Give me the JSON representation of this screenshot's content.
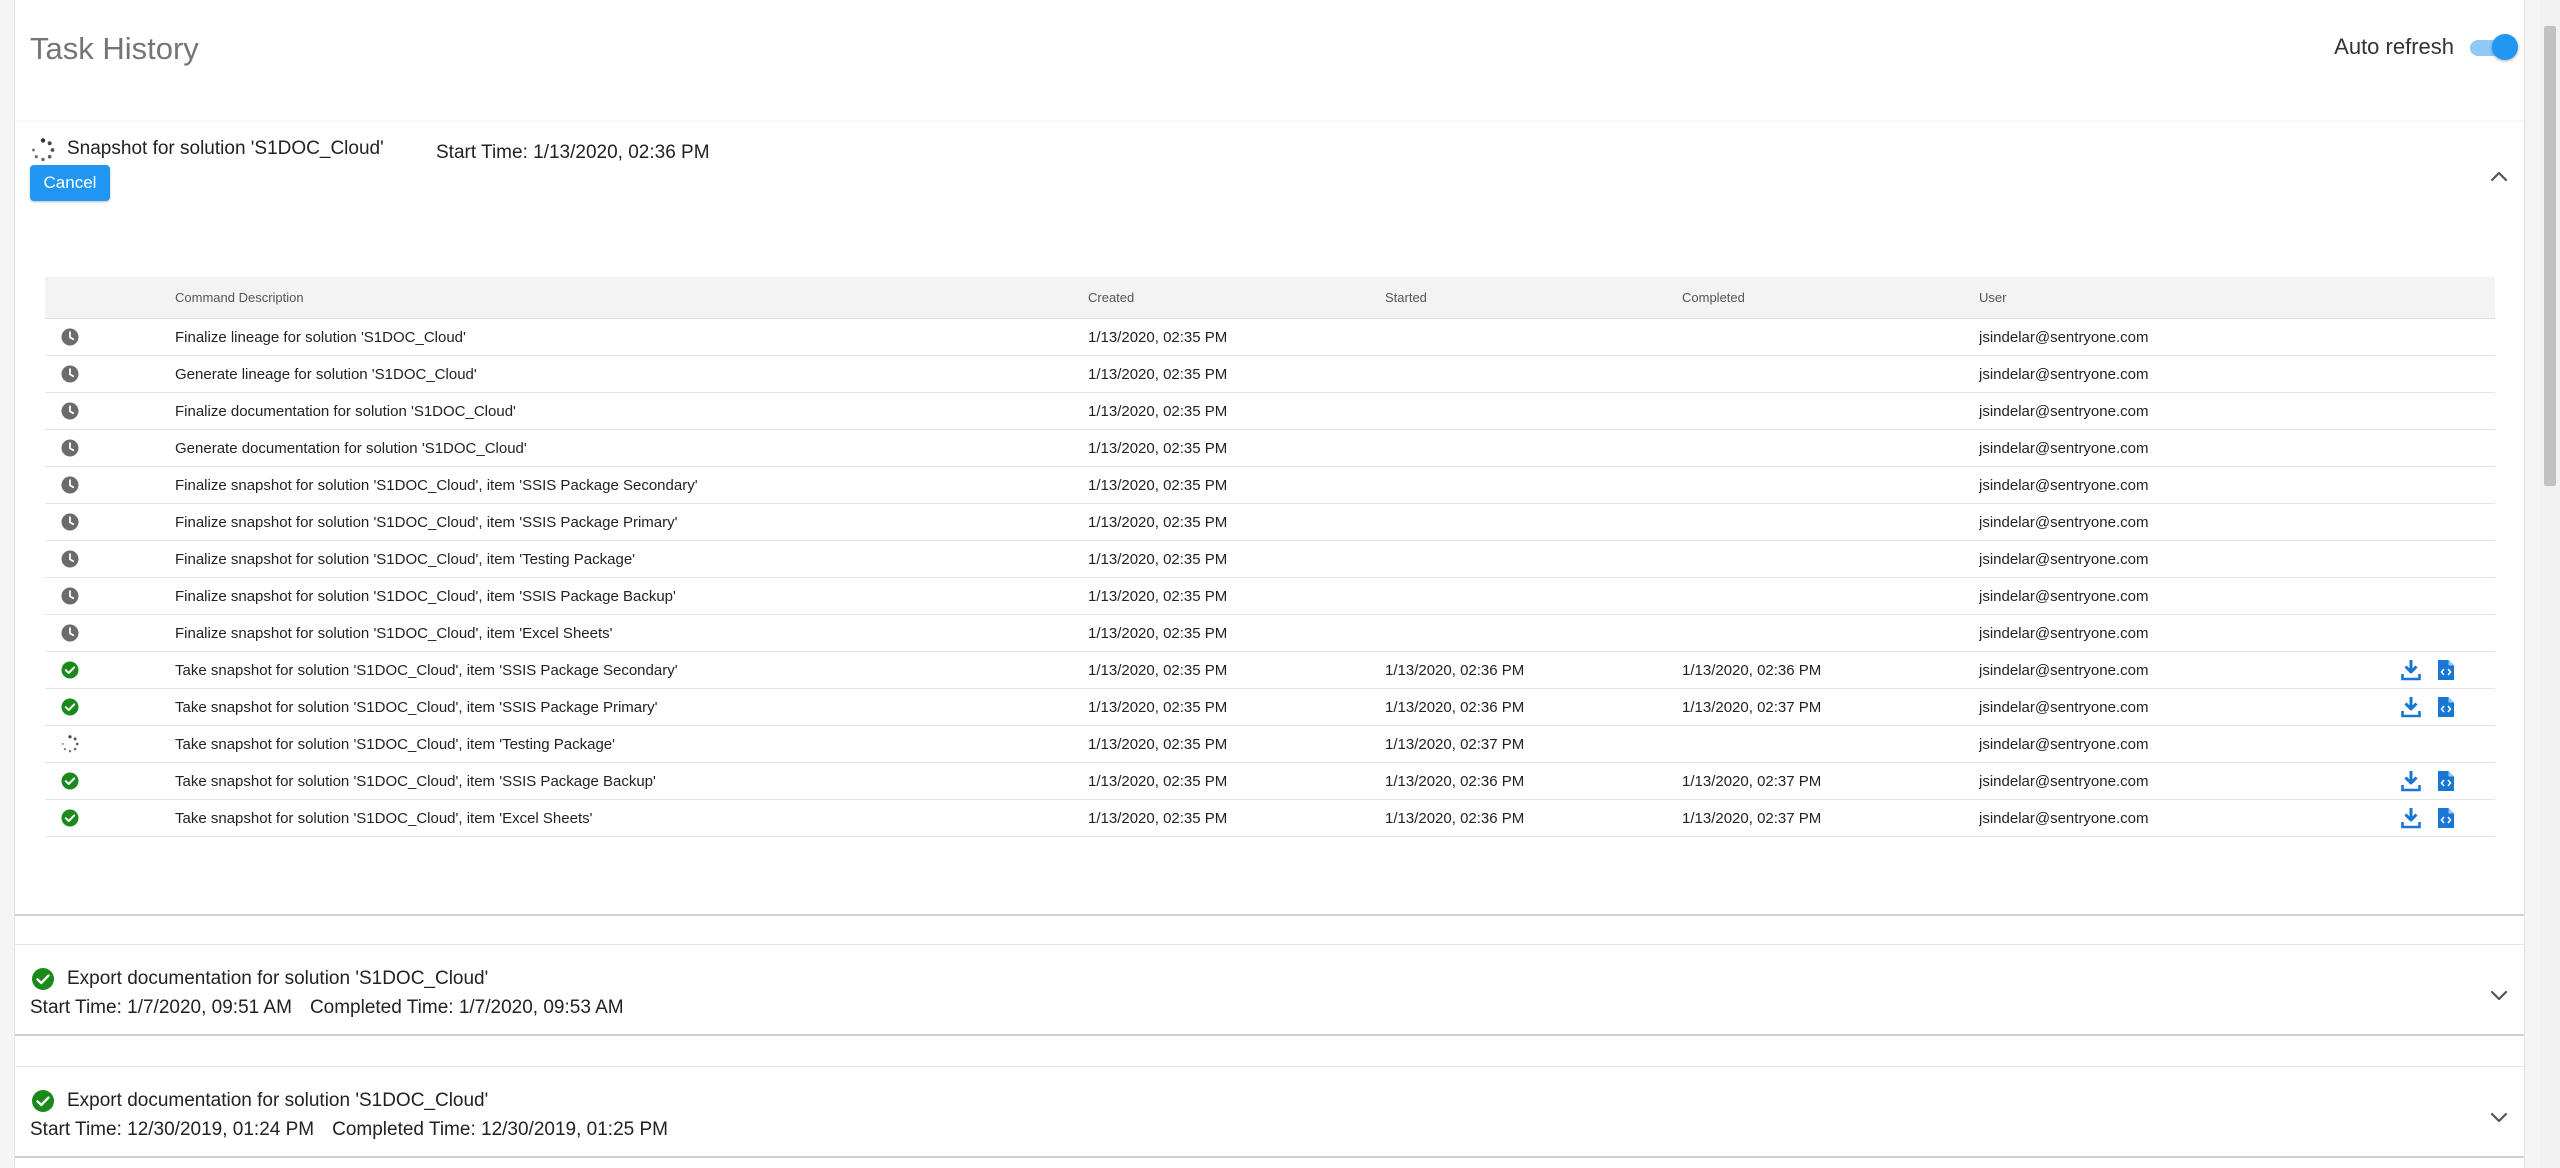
{
  "header": {
    "title": "Task History",
    "auto_refresh_label": "Auto refresh",
    "auto_refresh_on": true
  },
  "colors": {
    "accent": "#2196f3",
    "success": "#1a8a1a",
    "pending": "#757575"
  },
  "tasks": [
    {
      "title": "Snapshot for solution 'S1DOC_Cloud'",
      "status_icon": "spinner-icon",
      "start_time": "Start Time: 1/13/2020, 02:36 PM",
      "cancel_label": "Cancel",
      "expanded": true,
      "table": {
        "columns": [
          "Command Description",
          "Created",
          "Started",
          "Completed",
          "User"
        ],
        "rows": [
          {
            "status": "clock-icon",
            "description": "Finalize lineage for solution 'S1DOC_Cloud'",
            "created": "1/13/2020, 02:35 PM",
            "started": "",
            "completed": "",
            "user": "jsindelar@sentryone.com",
            "actions": false
          },
          {
            "status": "clock-icon",
            "description": "Generate lineage for solution 'S1DOC_Cloud'",
            "created": "1/13/2020, 02:35 PM",
            "started": "",
            "completed": "",
            "user": "jsindelar@sentryone.com",
            "actions": false
          },
          {
            "status": "clock-icon",
            "description": "Finalize documentation for solution 'S1DOC_Cloud'",
            "created": "1/13/2020, 02:35 PM",
            "started": "",
            "completed": "",
            "user": "jsindelar@sentryone.com",
            "actions": false
          },
          {
            "status": "clock-icon",
            "description": "Generate documentation for solution 'S1DOC_Cloud'",
            "created": "1/13/2020, 02:35 PM",
            "started": "",
            "completed": "",
            "user": "jsindelar@sentryone.com",
            "actions": false
          },
          {
            "status": "clock-icon",
            "description": "Finalize snapshot for solution 'S1DOC_Cloud', item 'SSIS Package Secondary'",
            "created": "1/13/2020, 02:35 PM",
            "started": "",
            "completed": "",
            "user": "jsindelar@sentryone.com",
            "actions": false
          },
          {
            "status": "clock-icon",
            "description": "Finalize snapshot for solution 'S1DOC_Cloud', item 'SSIS Package Primary'",
            "created": "1/13/2020, 02:35 PM",
            "started": "",
            "completed": "",
            "user": "jsindelar@sentryone.com",
            "actions": false
          },
          {
            "status": "clock-icon",
            "description": "Finalize snapshot for solution 'S1DOC_Cloud', item 'Testing Package'",
            "created": "1/13/2020, 02:35 PM",
            "started": "",
            "completed": "",
            "user": "jsindelar@sentryone.com",
            "actions": false
          },
          {
            "status": "clock-icon",
            "description": "Finalize snapshot for solution 'S1DOC_Cloud', item 'SSIS Package Backup'",
            "created": "1/13/2020, 02:35 PM",
            "started": "",
            "completed": "",
            "user": "jsindelar@sentryone.com",
            "actions": false
          },
          {
            "status": "clock-icon",
            "description": "Finalize snapshot for solution 'S1DOC_Cloud', item 'Excel Sheets'",
            "created": "1/13/2020, 02:35 PM",
            "started": "",
            "completed": "",
            "user": "jsindelar@sentryone.com",
            "actions": false
          },
          {
            "status": "check-circle-icon",
            "description": "Take snapshot for solution 'S1DOC_Cloud', item 'SSIS Package Secondary'",
            "created": "1/13/2020, 02:35 PM",
            "started": "1/13/2020, 02:36 PM",
            "completed": "1/13/2020, 02:36 PM",
            "user": "jsindelar@sentryone.com",
            "actions": true
          },
          {
            "status": "check-circle-icon",
            "description": "Take snapshot for solution 'S1DOC_Cloud', item 'SSIS Package Primary'",
            "created": "1/13/2020, 02:35 PM",
            "started": "1/13/2020, 02:36 PM",
            "completed": "1/13/2020, 02:37 PM",
            "user": "jsindelar@sentryone.com",
            "actions": true
          },
          {
            "status": "spinner-icon",
            "description": "Take snapshot for solution 'S1DOC_Cloud', item 'Testing Package'",
            "created": "1/13/2020, 02:35 PM",
            "started": "1/13/2020, 02:37 PM",
            "completed": "",
            "user": "jsindelar@sentryone.com",
            "actions": false
          },
          {
            "status": "check-circle-icon",
            "description": "Take snapshot for solution 'S1DOC_Cloud', item 'SSIS Package Backup'",
            "created": "1/13/2020, 02:35 PM",
            "started": "1/13/2020, 02:36 PM",
            "completed": "1/13/2020, 02:37 PM",
            "user": "jsindelar@sentryone.com",
            "actions": true
          },
          {
            "status": "check-circle-icon",
            "description": "Take snapshot for solution 'S1DOC_Cloud', item 'Excel Sheets'",
            "created": "1/13/2020, 02:35 PM",
            "started": "1/13/2020, 02:36 PM",
            "completed": "1/13/2020, 02:37 PM",
            "user": "jsindelar@sentryone.com",
            "actions": true
          }
        ]
      }
    },
    {
      "title": "Export documentation for solution 'S1DOC_Cloud'",
      "status_icon": "check-circle-icon",
      "start_time": "Start Time: 1/7/2020, 09:51 AM",
      "completed_time": "Completed Time: 1/7/2020, 09:53 AM",
      "expanded": false
    },
    {
      "title": "Export documentation for solution 'S1DOC_Cloud'",
      "status_icon": "check-circle-icon",
      "start_time": "Start Time: 12/30/2019, 01:24 PM",
      "completed_time": "Completed Time: 12/30/2019, 01:25 PM",
      "expanded": false
    }
  ]
}
